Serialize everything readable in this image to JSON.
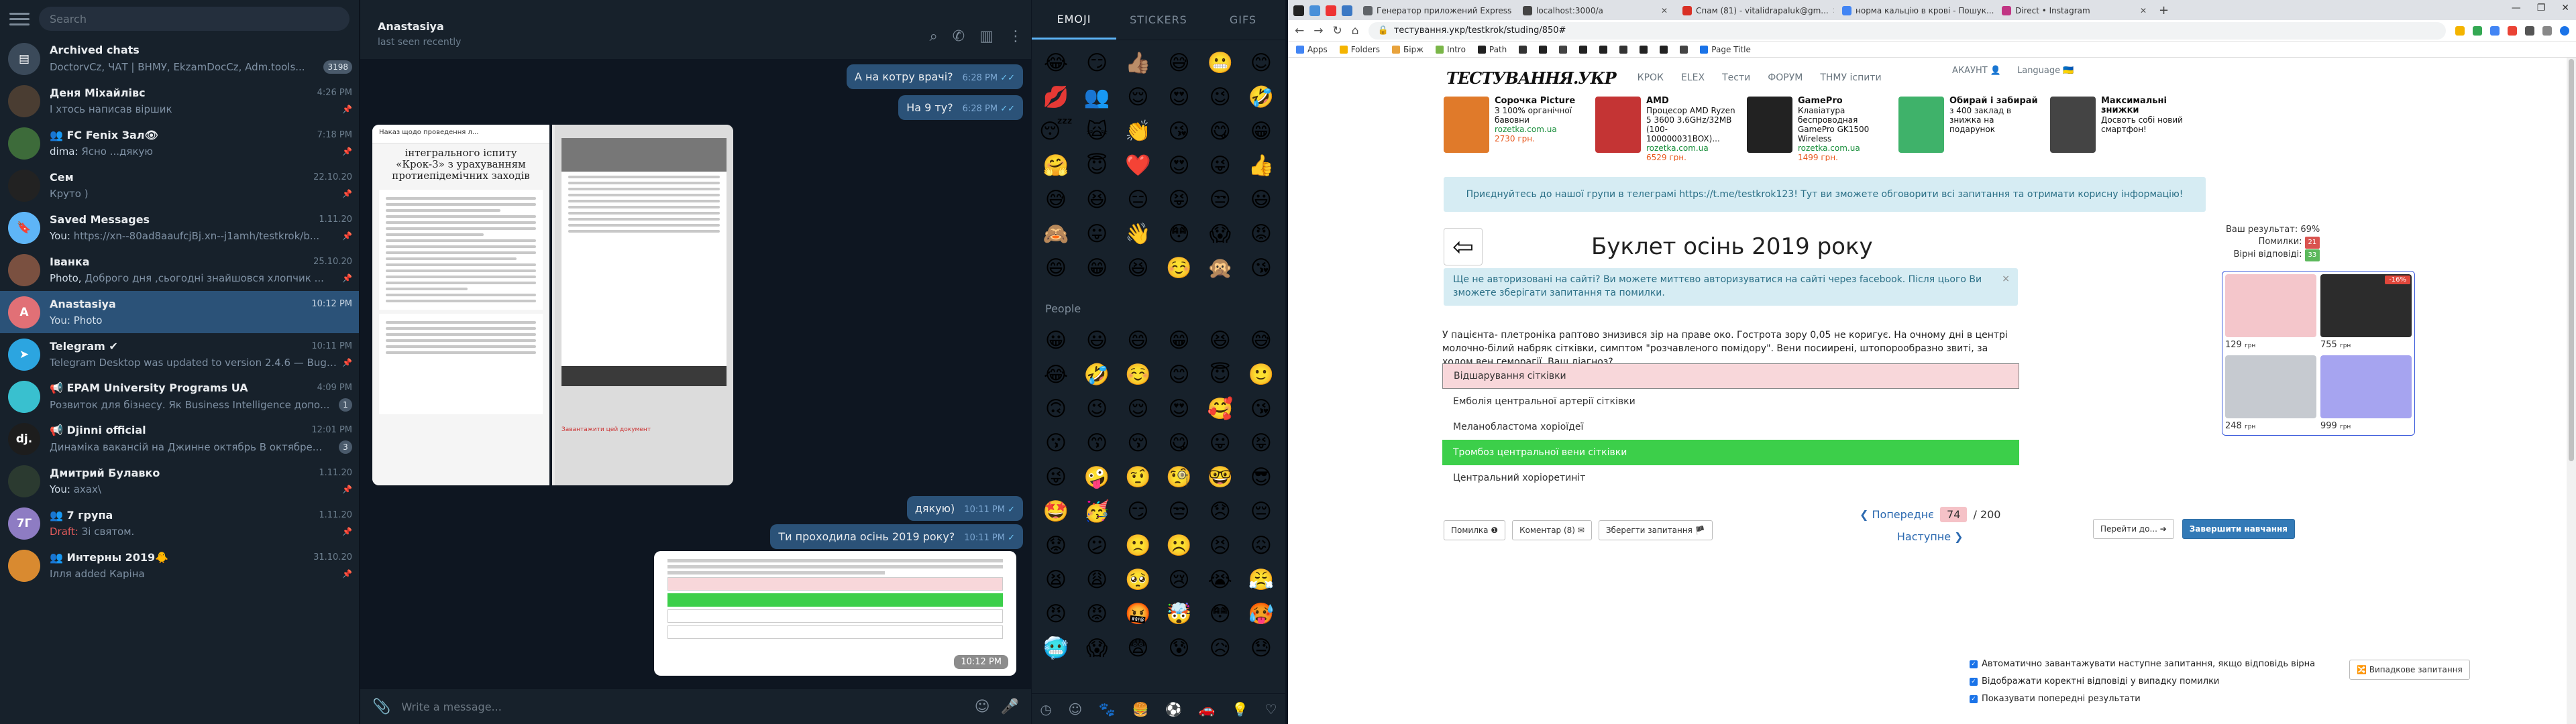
{
  "telegram": {
    "search_placeholder": "Search",
    "chats": [
      {
        "name": "Archived chats",
        "time": "",
        "preview": "DoctorvCz, ЧАТ | ВНМУ, ЕkzamDocCz, Adm.tools...",
        "who": "",
        "badge": "3198",
        "avatar_color": "#3b4a5a",
        "avatar_text": "▤",
        "active": false
      },
      {
        "name": "Деня Міхайлівс",
        "time": "4:26 PM",
        "preview": "І хтось написав віршик",
        "who": "",
        "badge": "",
        "avatar_color": "#4a3d32",
        "avatar_text": "",
        "active": false
      },
      {
        "name": "👥 FC Fenix Зал👁",
        "time": "7:18 PM",
        "preview": "Ясно ...дякую",
        "who": "dima: ",
        "badge": "",
        "avatar_color": "#3d6b3a",
        "avatar_text": "",
        "active": false
      },
      {
        "name": "Сем",
        "time": "22.10.20",
        "preview": "Круто )",
        "who": "",
        "badge": "",
        "avatar_color": "#222",
        "avatar_text": "",
        "active": false
      },
      {
        "name": "Saved Messages",
        "time": "1.11.20",
        "preview": "https://xn--80ad8aaufcjBj.xn--j1amh/testkrok/b...",
        "who": "You: ",
        "badge": "",
        "avatar_color": "#5eb5f7",
        "avatar_text": "🔖",
        "active": false
      },
      {
        "name": "Іванка",
        "time": "25.10.20",
        "preview": "Доброго дня ,сьогодні знайшовся хлопчик ...",
        "who": "Photo, ",
        "badge": "",
        "avatar_color": "#7a5040",
        "avatar_text": "",
        "active": false
      },
      {
        "name": "Anastasiya",
        "time": "10:12 PM",
        "preview": "Photo",
        "who": "You: ",
        "badge": "",
        "avatar_color": "#e17076",
        "avatar_text": "A",
        "active": true
      },
      {
        "name": "Telegram ✔",
        "time": "10:11 PM",
        "preview": "Telegram Desktop was updated to version 2.4.6 — Bug fi...",
        "who": "",
        "badge": "",
        "avatar_color": "#2ca5e0",
        "avatar_text": "➤",
        "active": false
      },
      {
        "name": "📢 EPAM University Programs UA",
        "time": "4:09 PM",
        "preview": "Розвиток для бізнесу. Як Business Intelligence допо...",
        "who": "",
        "badge": "1",
        "avatar_color": "#39c0cf",
        "avatar_text": "",
        "active": false
      },
      {
        "name": "📢 Djinni official",
        "time": "12:01 PM",
        "preview": "Динаміка вакансій на Джинне октябрь  В октябрe...",
        "who": "",
        "badge": "3",
        "avatar_color": "#1d1d1d",
        "avatar_text": "dj.",
        "active": false
      },
      {
        "name": "Дмитрий Булавко",
        "time": "1.11.20",
        "preview": "ахах\\",
        "who": "You: ",
        "badge": "",
        "avatar_color": "#2b3a30",
        "avatar_text": "",
        "active": false
      },
      {
        "name": "👥 7 група",
        "time": "1.11.20",
        "preview": "Зі святом.",
        "who": "Draft: ",
        "badge": "",
        "avatar_color": "#8e7cc3",
        "avatar_text": "7Г",
        "active": false
      },
      {
        "name": "👥 Интерны 2019🐥",
        "time": "31.10.20",
        "preview": "Ілля added Каріна",
        "who": "",
        "badge": "",
        "avatar_color": "#d98a30",
        "avatar_text": "",
        "active": false
      }
    ],
    "chat_header": {
      "name": "Anastasiya",
      "status": "last seen recently"
    },
    "messages": [
      {
        "text": "А на котру врачі?",
        "time": "6:28 PM"
      },
      {
        "text": "На 9 ту?",
        "time": "6:28 PM"
      },
      {
        "text": "дякую)",
        "time": "10:11 PM"
      },
      {
        "text": "Ти проходила осінь 2019 року?",
        "time": "10:11 PM"
      }
    ],
    "photo_doc_title": "інтегрального іспиту «Крок-3» з урахуванням протиепідемічних заходів",
    "photo_doc_header": "Наказ щодо проведення л...",
    "photo_doc_link": "Завантажити цей документ",
    "photo_time": "10:12 PM",
    "compose_placeholder": "Write a message..."
  },
  "emoji": {
    "tabs": [
      "EMOJI",
      "STICKERS",
      "GIFS"
    ],
    "recent": [
      "😂",
      "😏",
      "👍🏽",
      "😅",
      "😬",
      "😊",
      "💋",
      "👥",
      "😌",
      "😍",
      "😉",
      "🤣",
      "😴",
      "🙀",
      "👏",
      "😘",
      "😋",
      "😁",
      "🤗",
      "😇",
      "❤️",
      "😍",
      "😜",
      "👍",
      "😅",
      "😆",
      "😑",
      "😝",
      "😒",
      "😃",
      "🙈",
      "😛",
      "👋",
      "😳",
      "😱",
      "😡",
      "😄",
      "😁",
      "😆",
      "☺️",
      "🙊",
      "😘"
    ],
    "people_header": "People",
    "people": [
      "😀",
      "😃",
      "😄",
      "😁",
      "😆",
      "😅",
      "😂",
      "🤣",
      "☺️",
      "😊",
      "😇",
      "🙂",
      "🙃",
      "😉",
      "😌",
      "😍",
      "🥰",
      "😘",
      "😗",
      "😙",
      "😚",
      "😋",
      "😛",
      "😝",
      "😜",
      "🤪",
      "🤨",
      "🧐",
      "🤓",
      "😎",
      "🤩",
      "🥳",
      "😏",
      "😒",
      "😞",
      "😔",
      "😟",
      "😕",
      "🙁",
      "☹️",
      "😣",
      "😖",
      "😫",
      "😩",
      "🥺",
      "😢",
      "😭",
      "😤",
      "😠",
      "😡",
      "🤬",
      "🤯",
      "😳",
      "🥵",
      "🥶",
      "😱",
      "😨",
      "😰",
      "😥",
      "😓"
    ]
  },
  "browser": {
    "tabs": [
      {
        "title": "Генератор приложений Express",
        "color": "#5f6368",
        "active": false
      },
      {
        "title": "localhost:3000/a",
        "color": "#444",
        "active": false
      },
      {
        "title": "Спам (81) - vitalidrapaluk@gm...",
        "color": "#d93025",
        "active": false
      },
      {
        "title": "норма кальцію в крові - Пошук...",
        "color": "#4285f4",
        "active": false
      },
      {
        "title": "Direct • Instagram",
        "color": "#c13584",
        "active": false
      }
    ],
    "url": "тестування.укр/testkrok/studing/850#",
    "bookmarks": [
      "Apps",
      "Folders",
      "Бірж",
      "Intro",
      "Path",
      "",
      "",
      "",
      "",
      "",
      "",
      "",
      "",
      "",
      "Page Title"
    ],
    "site": {
      "logo": "ТЕСТУВАННЯ.УКР",
      "menu": [
        "КРОК",
        "ELEX",
        "Тести",
        "ФОРУМ",
        "ТНМУ іспити"
      ],
      "account": "АКАУНТ 👤",
      "language": "Language 🇺🇦",
      "ads": [
        {
          "title": "Сорочка Picture",
          "desc": "З 100% органічної бавовни",
          "src": "rozetka.com.ua",
          "price": "2730 грн.",
          "color": "#e07a2a"
        },
        {
          "title": "AMD",
          "desc": "Процесор AMD Ryzen 5 3600 3.6GHz/32MB (100-100000031BOX)...",
          "src": "rozetka.com.ua",
          "price": "6529 грн.",
          "color": "#c43434"
        },
        {
          "title": "GamePro",
          "desc": "Клавіатура беспроводная GamePro GK1500 Wireless",
          "src": "rozetka.com.ua",
          "price": "1499 грн.",
          "color": "#222"
        },
        {
          "title": "Обирай і забирай",
          "desc": "з 400 заклад в знижка на подарунок",
          "src": "",
          "price": "",
          "color": "#3fb26a"
        },
        {
          "title": "Максимальні знижки",
          "desc": "Досвоть собі новий смартфон!",
          "src": "",
          "price": "",
          "color": "#444"
        }
      ],
      "info_bar": "Приєднуйтесь до нашої групи в телеграмі https://t.me/testkrok123! Тут ви зможете обговорити всі запитання та отримати корисну інформацію!",
      "results": {
        "score_label": "Ваш результат:",
        "score": "69%",
        "errors_label": "Помилки:",
        "errors": "21",
        "correct_label": "Вірні відповіді:",
        "correct": "33"
      },
      "title": "Буклет осінь 2019 року",
      "warning": "Ще не авторизовані на сайті? Ви можете миттєво авторизуватися на сайті через facebook. Після цього Ви зможете зберігати запитання та помилки.",
      "question": "У пацієнта- плетроніка раптово знизився зір на праве око. Гострота зору 0,05 не коригує. На очному дні в центрі молочно-білий набряк сітківки, симптом \"розчавленого помідору\". Вени посиирені, штопорообразно звиті, за ходом вен геморагії. Ваш діагноз?",
      "answers": [
        {
          "text": "Відшарування сітківки",
          "state": "wrong"
        },
        {
          "text": "Емболія центральної артерії сітківки",
          "state": "plain"
        },
        {
          "text": "Меланобластома хоріоїдеї",
          "state": "plain"
        },
        {
          "text": "Тромбоз центральної вени сітківки",
          "state": "right"
        },
        {
          "text": "Центральний хоріоретиніт",
          "state": "plain"
        }
      ],
      "side_ads": [
        {
          "price": "129",
          "unit": "грн",
          "color": "#f4c6cb",
          "sale": ""
        },
        {
          "price": "755",
          "unit": "грн",
          "color": "#2c2c2c",
          "sale": "-16%"
        },
        {
          "price": "248",
          "unit": "грн",
          "color": "#c6cad0",
          "sale": ""
        },
        {
          "price": "999",
          "unit": "грн",
          "color": "#a6a4f0",
          "sale": ""
        }
      ],
      "tools": [
        "Помилка ❶",
        "Коментар (8) ✉",
        "Зберегти запитання 🏴"
      ],
      "pager": {
        "prev": "❮ Попереднє",
        "current": "74",
        "total": "/ 200",
        "next": "Наступне ❯"
      },
      "goto": "Перейти до... ➔",
      "finish": "Завершити навчання",
      "checks": [
        "Автоматично завантажувати наступне запитання, якщо відповідь вірна",
        "Відображати коректні відповіді у випадку помилки",
        "Показувати попередні результати"
      ],
      "random": "🔀 Випадкове запитання"
    }
  }
}
